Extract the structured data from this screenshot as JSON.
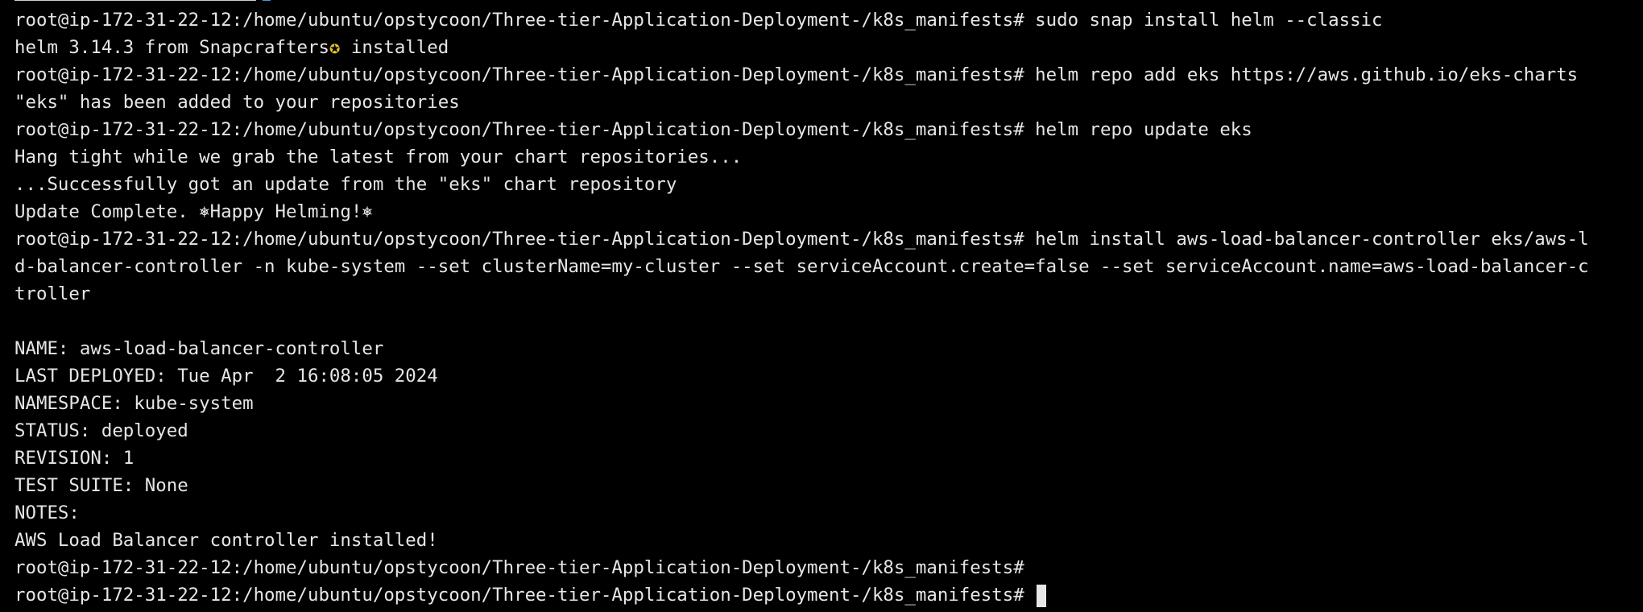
{
  "terminal": {
    "lines": [
      "root@ip-172-31-22-12:/home/ubuntu/opstycoon/Three-tier-Application-Deployment-/k8s_manifests# sudo snap install helm --classic",
      "helm 3.14.3 from Snapcrafters",
      "root@ip-172-31-22-12:/home/ubuntu/opstycoon/Three-tier-Application-Deployment-/k8s_manifests# helm repo add eks https://aws.github.io/eks-charts",
      "\"eks\" has been added to your repositories",
      "root@ip-172-31-22-12:/home/ubuntu/opstycoon/Three-tier-Application-Deployment-/k8s_manifests# helm repo update eks",
      "Hang tight while we grab the latest from your chart repositories...",
      "...Successfully got an update from the \"eks\" chart repository",
      "Update Complete. ⎈Happy Helming!⎈",
      "root@ip-172-31-22-12:/home/ubuntu/opstycoon/Three-tier-Application-Deployment-/k8s_manifests# helm install aws-load-balancer-controller eks/aws-l",
      "d-balancer-controller -n kube-system --set clusterName=my-cluster --set serviceAccount.create=false --set serviceAccount.name=aws-load-balancer-c",
      "troller",
      "",
      "NAME: aws-load-balancer-controller",
      "LAST DEPLOYED: Tue Apr  2 16:08:05 2024",
      "NAMESPACE: kube-system",
      "STATUS: deployed",
      "REVISION: 1",
      "TEST SUITE: None",
      "NOTES:",
      "AWS Load Balancer controller installed!",
      "root@ip-172-31-22-12:/home/ubuntu/opstycoon/Three-tier-Application-Deployment-/k8s_manifests#",
      "root@ip-172-31-22-12:/home/ubuntu/opstycoon/Three-tier-Application-Deployment-/k8s_manifests#"
    ],
    "helm_publisher_badge": "✪",
    "helm_installed_suffix": " installed",
    "colors": {
      "background": "#000000",
      "foreground": "#e6e6e6",
      "badge": "#e3c320"
    }
  }
}
